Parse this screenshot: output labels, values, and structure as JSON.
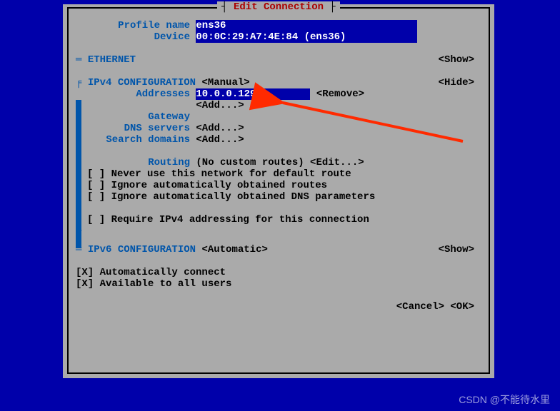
{
  "title": "Edit Connection",
  "profile": {
    "name_label": "Profile name",
    "name_value": "ens36",
    "device_label": "Device",
    "device_value": "00:0C:29:A7:4E:84 (ens36)"
  },
  "ethernet": {
    "header": "ETHERNET",
    "toggle": "<Show>"
  },
  "ipv4": {
    "header": "IPv4 CONFIGURATION",
    "mode": "<Manual>",
    "toggle": "<Hide>",
    "addresses_label": "Addresses",
    "addresses_value": "10.0.0.129",
    "addresses_remove": "<Remove>",
    "add": "<Add...>",
    "gateway_label": "Gateway",
    "gateway_value": "",
    "dns_label": "DNS servers",
    "dns_add": "<Add...>",
    "search_label": "Search domains",
    "search_add": "<Add...>",
    "routing_label": "Routing",
    "routing_value": "(No custom routes)",
    "routing_edit": "<Edit...>",
    "cb1": "[ ] Never use this network for default route",
    "cb2": "[ ] Ignore automatically obtained routes",
    "cb3": "[ ] Ignore automatically obtained DNS parameters",
    "cb4": "[ ] Require IPv4 addressing for this connection"
  },
  "ipv6": {
    "header": "IPv6 CONFIGURATION",
    "mode": "<Automatic>",
    "toggle": "<Show>"
  },
  "autoconnect": "[X] Automatically connect",
  "allusers": "[X] Available to all users",
  "buttons": {
    "cancel": "<Cancel>",
    "ok": "<OK>"
  },
  "watermark": "CSDN @不能待水里",
  "sep_eq": "=",
  "sep_pipe": "┌"
}
